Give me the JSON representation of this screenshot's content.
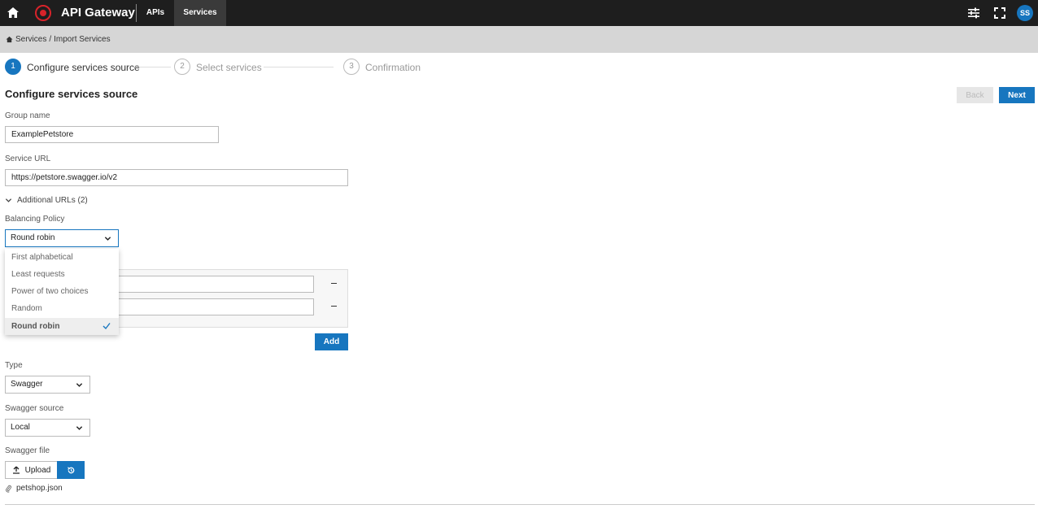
{
  "header": {
    "brand": "API Gateway",
    "tabs": [
      {
        "label": "APIs"
      },
      {
        "label": "Services"
      }
    ],
    "avatar_initials": "SS",
    "accent_color": "#1776bf",
    "logo_color": "#d8232a"
  },
  "breadcrumb": {
    "items": [
      "Services",
      "Import Services"
    ],
    "separator": "/"
  },
  "stepper": {
    "steps": [
      {
        "number": "1",
        "label": "Configure services source",
        "state": "active"
      },
      {
        "number": "2",
        "label": "Select services",
        "state": "pending"
      },
      {
        "number": "3",
        "label": "Confirmation",
        "state": "pending"
      }
    ]
  },
  "form": {
    "title": "Configure services source",
    "back_label": "Back",
    "next_label": "Next",
    "group_name_label": "Group name",
    "group_name_value": "ExamplePetstore",
    "service_url_label": "Service URL",
    "service_url_value": "https://petstore.swagger.io/v2",
    "additional_urls_label": "Additional URLs (2)",
    "balancing_policy_label": "Balancing Policy",
    "balancing_policy_value": "Round robin",
    "balancing_policy_options": [
      "First alphabetical",
      "Least requests",
      "Power of two choices",
      "Random",
      "Round robin"
    ],
    "add_label": "Add",
    "type_label": "Type",
    "type_value": "Swagger",
    "swagger_source_label": "Swagger source",
    "swagger_source_value": "Local",
    "swagger_file_label": "Swagger file",
    "upload_label": "Upload",
    "file_name": "petshop.json"
  }
}
